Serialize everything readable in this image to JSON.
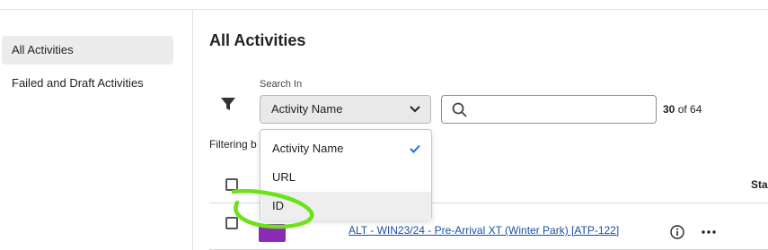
{
  "sidebar": {
    "items": [
      {
        "label": "All Activities",
        "active": true
      },
      {
        "label": "Failed and Draft Activities",
        "active": false
      }
    ]
  },
  "main": {
    "title": "All Activities",
    "search_in_label": "Search In",
    "search_in_selected": "Activity Name",
    "search": {
      "value": "",
      "placeholder": ""
    },
    "count": {
      "shown": "30",
      "of_text": "of 64"
    },
    "filtering_text": "Filtering b"
  },
  "table": {
    "status_header": "Sta",
    "rows": [
      {
        "title": "ALT - WIN23/24 - Pre-Arrival XT (Winter Park) [ATP-122]"
      }
    ]
  },
  "dropdown": {
    "options": [
      {
        "label": "Activity Name",
        "selected": true
      },
      {
        "label": "URL",
        "selected": false
      },
      {
        "label": "ID",
        "selected": false,
        "hovered": true
      }
    ]
  },
  "colors": {
    "annotation": "#6be21a",
    "link": "#1a4fa8",
    "thumb": "#8b2bb5",
    "status_dot": "#2d9d78"
  },
  "icons": [
    "filter-icon",
    "chevron-down-icon",
    "search-icon",
    "checkmark-icon",
    "info-icon",
    "more-icon"
  ]
}
